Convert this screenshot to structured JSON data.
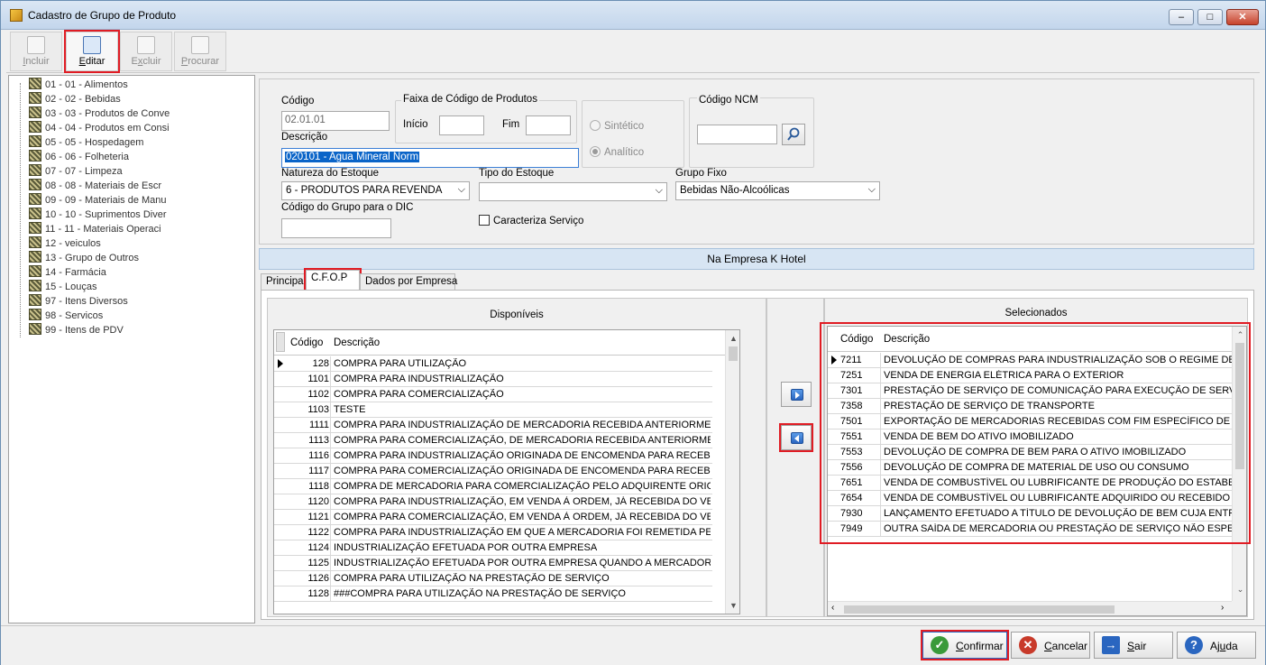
{
  "window": {
    "title": "Cadastro de Grupo de Produto"
  },
  "toolbar": {
    "incluir": {
      "pre": "",
      "key": "I",
      "post": "ncluir"
    },
    "editar": {
      "pre": "",
      "key": "E",
      "post": "ditar"
    },
    "excluir": {
      "pre": "E",
      "key": "x",
      "post": "cluir"
    },
    "procurar": {
      "pre": "",
      "key": "P",
      "post": "rocurar"
    }
  },
  "tree": [
    "01 - 01 - Alimentos",
    "02 - 02 - Bebidas",
    "03 - 03 - Produtos de Conve",
    "04 - 04 - Produtos em Consi",
    "05 - 05 - Hospedagem",
    "06 - 06 - Folheteria",
    "07 - 07 - Limpeza",
    "08 - 08 - Materiais de Escr",
    "09 - 09 - Materiais de Manu",
    "10 - 10 - Suprimentos Diver",
    "11 - 11 - Materiais Operaci",
    "12 - veiculos",
    "13 - Grupo de Outros",
    "14 - Farmácia",
    "15 - Louças",
    "97 - Itens Diversos",
    "98 - Servicos",
    "99 - Itens de PDV"
  ],
  "form": {
    "codigo_label": "Código",
    "codigo_value": "02.01.01",
    "descricao_label": "Descrição",
    "descricao_value": "020101 - Agua Mineral Norm",
    "faixa_title": "Faixa de Código de Produtos",
    "inicio_label": "Início",
    "fim_label": "Fim",
    "sintetico": "Sintético",
    "analitico": "Analítico",
    "ncm_title": "Código NCM",
    "natureza_label": "Natureza do Estoque",
    "natureza_value": "6 - PRODUTOS PARA REVENDA",
    "tipo_label": "Tipo do Estoque",
    "tipo_value": "",
    "grupo_label": "Grupo Fixo",
    "grupo_value": "Bebidas Não-Alcoólicas",
    "dic_label": "Código do Grupo para o DIC",
    "caracteriza": "Caracteriza Serviço"
  },
  "company_bar": "Na Empresa K Hotel",
  "tabs": [
    "Principal",
    "C.F.O.P",
    "Dados por Empresa"
  ],
  "disponiveis": {
    "title": "Disponíveis",
    "col_codigo": "Código",
    "col_descricao": "Descrição",
    "rows": [
      [
        "128",
        "COMPRA PARA UTILIZAÇÃO"
      ],
      [
        "1101",
        "COMPRA PARA INDUSTRIALIZAÇÃO"
      ],
      [
        "1102",
        "COMPRA PARA COMERCIALIZAÇÃO"
      ],
      [
        "1103",
        "TESTE"
      ],
      [
        "1111",
        "COMPRA PARA INDUSTRIALIZAÇÃO DE MERCADORIA RECEBIDA ANTERIORMENTE E"
      ],
      [
        "1113",
        "COMPRA PARA COMERCIALIZAÇÃO, DE MERCADORIA RECEBIDA ANTERIORMENTE I"
      ],
      [
        "1116",
        "COMPRA PARA INDUSTRIALIZAÇÃO ORIGINADA DE ENCOMENDA PARA RECEBIMENT"
      ],
      [
        "1117",
        "COMPRA PARA COMERCIALIZAÇÃO ORIGINADA DE ENCOMENDA PARA RECEBIMENT"
      ],
      [
        "1118",
        "COMPRA DE MERCADORIA PARA COMERCIALIZAÇÃO PELO ADQUIRENTE ORIGINÁR"
      ],
      [
        "1120",
        "COMPRA PARA INDUSTRIALIZAÇÃO, EM VENDA À ORDEM, JÁ RECEBIDA DO VENDEI"
      ],
      [
        "1121",
        "COMPRA PARA COMERCIALIZAÇÃO, EM VENDA À ORDEM, JÁ RECEBIDA DO VENDEI"
      ],
      [
        "1122",
        "COMPRA PARA INDUSTRIALIZAÇÃO EM QUE A MERCADORIA FOI REMETIDA PELO F"
      ],
      [
        "1124",
        "INDUSTRIALIZAÇÃO EFETUADA POR OUTRA EMPRESA"
      ],
      [
        "1125",
        "INDUSTRIALIZAÇÃO EFETUADA POR OUTRA EMPRESA QUANDO A MERCADORIA RE"
      ],
      [
        "1126",
        "COMPRA PARA UTILIZAÇÃO NA PRESTAÇÃO DE SERVIÇO"
      ],
      [
        "1128",
        "###COMPRA PARA UTILIZAÇÃO NA PRESTAÇÃO DE SERVIÇO"
      ]
    ]
  },
  "selecionados": {
    "title": "Selecionados",
    "col_codigo": "Código",
    "col_descricao": "Descrição",
    "rows": [
      [
        "7211",
        "DEVOLUÇÃO DE COMPRAS PARA INDUSTRIALIZAÇÃO SOB O REGIME DE DRA"
      ],
      [
        "7251",
        "VENDA DE ENERGIA ELÉTRICA PARA O EXTERIOR"
      ],
      [
        "7301",
        "PRESTAÇÃO DE SERVIÇO DE COMUNICAÇÃO PARA EXECUÇÃO DE SERVIÇO D"
      ],
      [
        "7358",
        "PRESTAÇÃO DE SERVIÇO DE TRANSPORTE"
      ],
      [
        "7501",
        "EXPORTAÇÃO DE MERCADORIAS RECEBIDAS COM FIM ESPECÍFICO DE EXPO"
      ],
      [
        "7551",
        "VENDA DE BEM DO ATIVO IMOBILIZADO"
      ],
      [
        "7553",
        "DEVOLUÇÃO DE COMPRA DE BEM PARA O ATIVO IMOBILIZADO"
      ],
      [
        "7556",
        "DEVOLUÇÃO DE COMPRA DE MATERIAL DE USO OU CONSUMO"
      ],
      [
        "7651",
        "VENDA DE COMBUSTÍVEL OU LUBRIFICANTE DE PRODUÇÃO DO ESTABELECI"
      ],
      [
        "7654",
        "VENDA DE COMBUSTÍVEL OU LUBRIFICANTE ADQUIRIDO OU RECEBIDO DE T"
      ],
      [
        "7930",
        "LANÇAMENTO EFETUADO A TÍTULO DE DEVOLUÇÃO DE BEM CUJA ENTRADA"
      ],
      [
        "7949",
        "OUTRA SAÍDA DE MERCADORIA OU PRESTAÇÃO DE SERVIÇO NÃO ESPECIFIC"
      ]
    ]
  },
  "footer": {
    "confirmar": {
      "pre": "",
      "key": "C",
      "post": "onfirmar"
    },
    "cancelar": {
      "pre": "",
      "key": "C",
      "post": "ancelar"
    },
    "sair": {
      "pre": "",
      "key": "S",
      "post": "air"
    },
    "ajuda": {
      "pre": "Aj",
      "key": "u",
      "post": "da"
    }
  },
  "colors": {
    "highlight": "#e01c24",
    "selection": "#0a64c8",
    "company_bar": "#d7e5f3"
  }
}
